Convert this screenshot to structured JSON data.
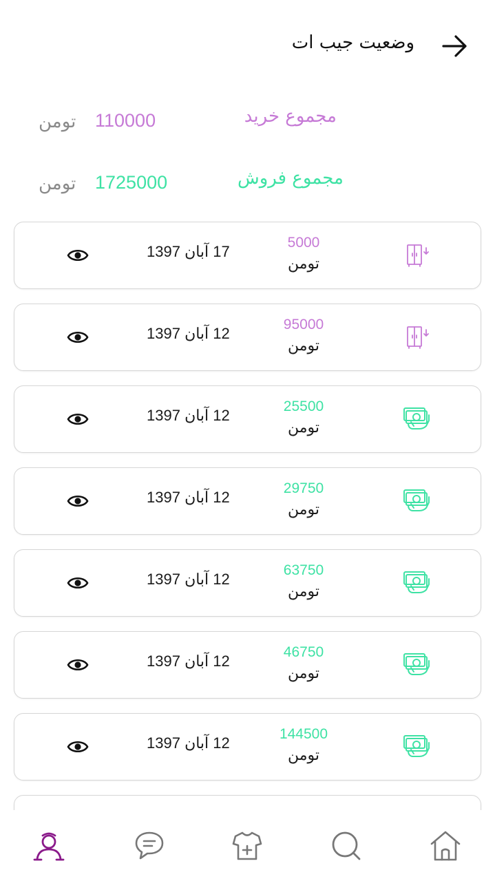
{
  "header": {
    "title": "وضعیت جیب ات",
    "back_icon": "arrow-right-icon"
  },
  "summary": {
    "purchase": {
      "label": "مجموع خرید",
      "value": "110000",
      "unit": "تومن",
      "color": "#c67ad6"
    },
    "sales": {
      "label": "مجموع فروش",
      "value": "1725000",
      "unit": "تومن",
      "color": "#3ee2a4"
    }
  },
  "colors": {
    "purchase": "#c67ad6",
    "sale": "#3ee2a4",
    "nav_active": "#8a1a8a",
    "nav_inactive": "#777777"
  },
  "transactions": [
    {
      "amount": "5000",
      "unit": "تومن",
      "date": "17 آبان 1397",
      "type": "purchase",
      "icon": "wardrobe-icon",
      "view_icon": "eye-icon"
    },
    {
      "amount": "95000",
      "unit": "تومن",
      "date": "12 آبان 1397",
      "type": "purchase",
      "icon": "wardrobe-icon",
      "view_icon": "eye-icon"
    },
    {
      "amount": "25500",
      "unit": "تومن",
      "date": "12 آبان 1397",
      "type": "sale",
      "icon": "cash-hand-icon",
      "view_icon": "eye-icon"
    },
    {
      "amount": "29750",
      "unit": "تومن",
      "date": "12 آبان 1397",
      "type": "sale",
      "icon": "cash-hand-icon",
      "view_icon": "eye-icon"
    },
    {
      "amount": "63750",
      "unit": "تومن",
      "date": "12 آبان 1397",
      "type": "sale",
      "icon": "cash-hand-icon",
      "view_icon": "eye-icon"
    },
    {
      "amount": "46750",
      "unit": "تومن",
      "date": "12 آبان 1397",
      "type": "sale",
      "icon": "cash-hand-icon",
      "view_icon": "eye-icon"
    },
    {
      "amount": "144500",
      "unit": "تومن",
      "date": "12 آبان 1397",
      "type": "sale",
      "icon": "cash-hand-icon",
      "view_icon": "eye-icon"
    }
  ],
  "nav": {
    "items": [
      {
        "icon": "profile-icon",
        "active": true
      },
      {
        "icon": "chat-icon",
        "active": false
      },
      {
        "icon": "add-clothing-icon",
        "active": false
      },
      {
        "icon": "search-icon",
        "active": false
      },
      {
        "icon": "home-icon",
        "active": false
      }
    ]
  }
}
